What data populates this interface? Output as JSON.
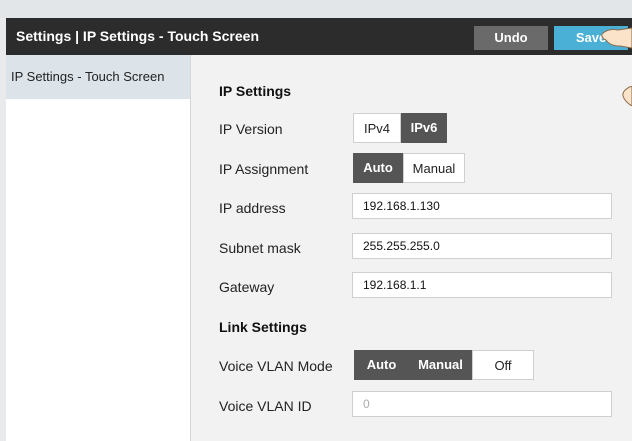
{
  "header": {
    "title": "Settings  |  IP Settings - Touch Screen",
    "undo_label": "Undo",
    "save_label": "Save"
  },
  "sidebar": {
    "items": [
      {
        "label": "IP Settings - Touch Screen"
      }
    ]
  },
  "ip_settings": {
    "heading": "IP Settings",
    "ip_version": {
      "label": "IP Version",
      "options": [
        "IPv4",
        "IPv6"
      ],
      "selected": "IPv6"
    },
    "ip_assignment": {
      "label": "IP Assignment",
      "options": [
        "Auto",
        "Manual"
      ],
      "selected": "Auto"
    },
    "ip_address": {
      "label": "IP address",
      "value": "192.168.1.130"
    },
    "subnet_mask": {
      "label": "Subnet mask",
      "value": "255.255.255.0"
    },
    "gateway": {
      "label": "Gateway",
      "value": "192.168.1.1"
    }
  },
  "link_settings": {
    "heading": "Link Settings",
    "voice_vlan_mode": {
      "label": "Voice VLAN Mode",
      "options": [
        "Auto",
        "Manual",
        "Off"
      ],
      "selected": "Off"
    },
    "voice_vlan_id": {
      "label": "Voice VLAN ID",
      "placeholder": "0"
    }
  },
  "colors": {
    "header_bg": "#2c2c2c",
    "save_accent": "#4ab0d6",
    "selected_segment": "#555555"
  }
}
